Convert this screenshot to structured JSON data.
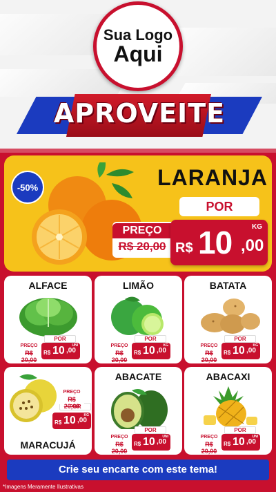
{
  "header": {
    "logo_line1": "Sua Logo",
    "logo_line2": "Aqui",
    "banner": "APROVEITE"
  },
  "featured": {
    "badge": "-50%",
    "name": "LARANJA",
    "por": "POR",
    "preco_label": "PREÇO",
    "old_price": "R$ 20,00",
    "currency": "R$",
    "price_int": "10",
    "price_dec": ",00",
    "unit": "KG"
  },
  "products": [
    {
      "name": "ALFACE",
      "por": "POR",
      "preco_label": "PREÇO",
      "old_price": "R$ 20,00",
      "currency": "R$",
      "price_int": "10",
      "price_dec": ",00",
      "unit": "UNI"
    },
    {
      "name": "LIMÃO",
      "por": "POR",
      "preco_label": "PREÇO",
      "old_price": "R$ 20,00",
      "currency": "R$",
      "price_int": "10",
      "price_dec": ",00",
      "unit": "KG"
    },
    {
      "name": "BATATA",
      "por": "POR",
      "preco_label": "PREÇO",
      "old_price": "R$ 20,00",
      "currency": "R$",
      "price_int": "10",
      "price_dec": ",00",
      "unit": "KG"
    },
    {
      "name": "MARACUJÁ",
      "por": "POR",
      "preco_label": "PREÇO",
      "old_price": "R$ 20,00",
      "currency": "R$",
      "price_int": "10",
      "price_dec": ",00",
      "unit": "KG"
    },
    {
      "name": "ABACATE",
      "por": "POR",
      "preco_label": "PREÇO",
      "old_price": "R$ 20,00",
      "currency": "R$",
      "price_int": "10",
      "price_dec": ",00",
      "unit": "UNI"
    },
    {
      "name": "ABACAXI",
      "por": "POR",
      "preco_label": "PREÇO",
      "old_price": "R$ 20,00",
      "currency": "R$",
      "price_int": "10",
      "price_dec": ",00",
      "unit": "UNI"
    }
  ],
  "cta": "Crie seu encarte com este tema!",
  "disclaimer": "*Imagens Meramente Ilustrativas",
  "colors": {
    "red": "#c8102e",
    "blue": "#1b3bbf",
    "yellow": "#f6c21a"
  }
}
